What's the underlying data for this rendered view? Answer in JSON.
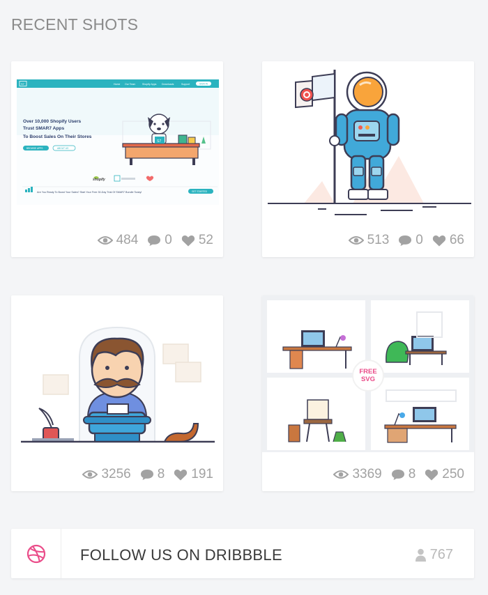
{
  "heading": "RECENT SHOTS",
  "shots": [
    {
      "views": "484",
      "comments": "0",
      "likes": "52",
      "preview": {
        "headline1": "Over 10,000 Shopify Users",
        "headline2": "Trust SMAR7 Apps",
        "headline3": "To Boost Sales On Their Stores",
        "nav": [
          "Home",
          "Our Team",
          "Shopify Apps",
          "Downloads",
          "Support"
        ],
        "cta": "SIGN IN",
        "btn1": "BROWSE APPS",
        "btn2": "ABOUT US",
        "badge": "S7",
        "shopify": "shopify",
        "bottom": "Are You Ready To Boost Your Sales? Start Your Free 30-Day Trial Of SMAR7 Bundle Today!",
        "bottom_btn": "GET STARTED"
      }
    },
    {
      "views": "513",
      "comments": "0",
      "likes": "66"
    },
    {
      "views": "3256",
      "comments": "8",
      "likes": "191"
    },
    {
      "views": "3369",
      "comments": "8",
      "likes": "250",
      "badge_line1": "FREE",
      "badge_line2": "SVG"
    }
  ],
  "follow": {
    "label": "FOLLOW US ON DRIBBBLE",
    "count": "767"
  },
  "colors": {
    "accent": "#ea4c89",
    "teal": "#1fb8c3",
    "muted": "#a2a2a2"
  }
}
